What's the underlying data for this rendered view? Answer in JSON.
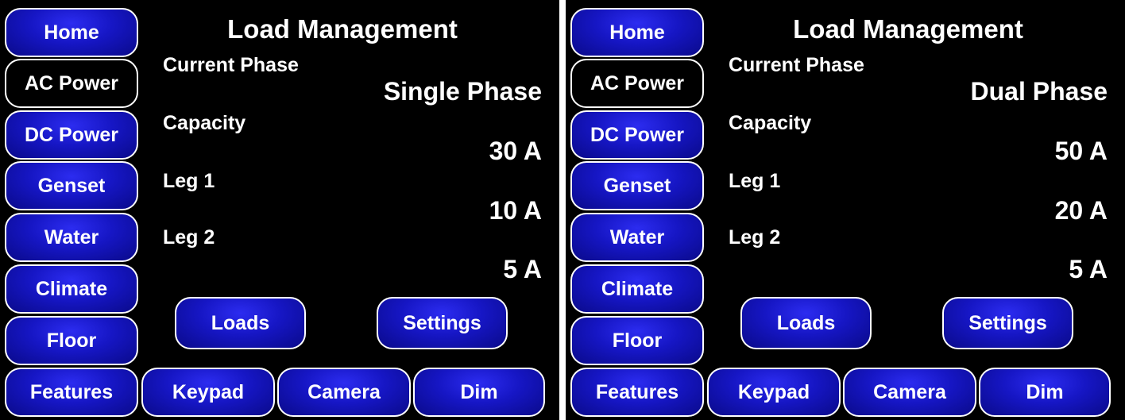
{
  "nav": {
    "home": "Home",
    "ac_power": "AC Power",
    "dc_power": "DC Power",
    "genset": "Genset",
    "water": "Water",
    "climate": "Climate",
    "floor": "Floor",
    "features": "Features",
    "keypad": "Keypad",
    "camera": "Camera",
    "dim": "Dim"
  },
  "screens": [
    {
      "title": "Load Management",
      "labels": {
        "current_phase": "Current Phase",
        "capacity": "Capacity",
        "leg1": "Leg 1",
        "leg2": "Leg 2"
      },
      "values": {
        "current_phase": "Single Phase",
        "capacity": "30 A",
        "leg1": "10 A",
        "leg2": "5 A"
      },
      "actions": {
        "loads": "Loads",
        "settings": "Settings"
      }
    },
    {
      "title": "Load Management",
      "labels": {
        "current_phase": "Current Phase",
        "capacity": "Capacity",
        "leg1": "Leg 1",
        "leg2": "Leg 2"
      },
      "values": {
        "current_phase": "Dual Phase",
        "capacity": "50 A",
        "leg1": "20 A",
        "leg2": "5 A"
      },
      "actions": {
        "loads": "Loads",
        "settings": "Settings"
      }
    }
  ],
  "colors": {
    "background": "#000000",
    "button_blue": "#1616c4",
    "button_border": "#ffffff",
    "text": "#ffffff"
  }
}
